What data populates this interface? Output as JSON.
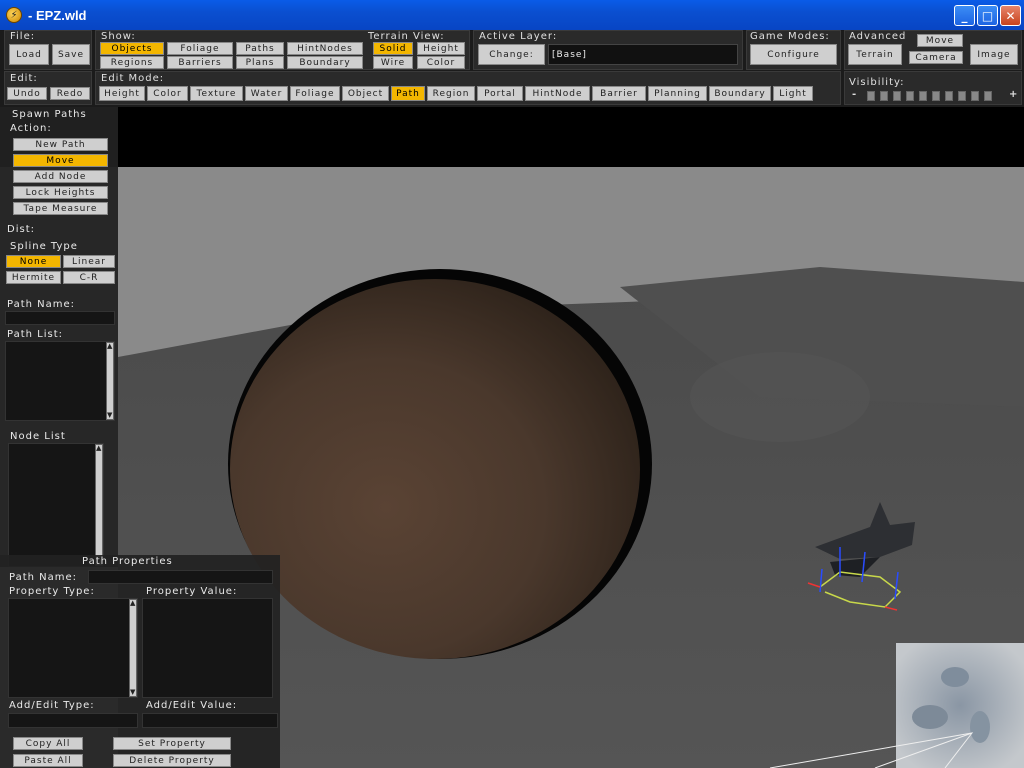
{
  "window": {
    "title": "- EPZ.wld",
    "app_icon": "app-icon"
  },
  "toolbar": {
    "file": {
      "label": "File:",
      "load": "Load",
      "save": "Save"
    },
    "show": {
      "label": "Show:",
      "buttons": [
        "Objects",
        "Foliage",
        "Paths",
        "HintNodes",
        "Regions",
        "Barriers",
        "Plans",
        "Boundary"
      ],
      "active": "Objects"
    },
    "terrain_view": {
      "label": "Terrain View:",
      "buttons": [
        "Solid",
        "Height",
        "Wire",
        "Color"
      ],
      "active": "Solid"
    },
    "active_layer": {
      "label": "Active Layer:",
      "change": "Change:",
      "value": "[Base]"
    },
    "game_modes": {
      "label": "Game Modes:",
      "configure": "Configure"
    },
    "advanced": {
      "label": "Advanced",
      "terrain": "Terrain",
      "move": "Move",
      "camera": "Camera",
      "image": "Image"
    },
    "edit": {
      "label": "Edit:",
      "undo": "Undo",
      "redo": "Redo"
    },
    "edit_mode": {
      "label": "Edit Mode:",
      "buttons": [
        "Height",
        "Color",
        "Texture",
        "Water",
        "Foliage",
        "Object",
        "Path",
        "Region",
        "Portal",
        "HintNode",
        "Barrier",
        "Planning",
        "Boundary",
        "Light"
      ],
      "active": "Path"
    },
    "visibility": {
      "label": "Visibility:",
      "minus": "-",
      "plus": "+",
      "slots": 10
    }
  },
  "spawn_panel": {
    "title": "Spawn Paths",
    "action_label": "Action:",
    "actions": [
      "New Path",
      "Move",
      "Add Node",
      "Lock Heights",
      "Tape Measure"
    ],
    "active_action": "Move",
    "dist_label": "Dist:",
    "spline_label": "Spline Type",
    "splines": [
      "None",
      "Linear",
      "Hermite",
      "C-R"
    ],
    "active_spline": "None",
    "path_name_label": "Path Name:",
    "path_name_value": "",
    "path_list_label": "Path List:",
    "node_list_label": "Node List"
  },
  "properties_panel": {
    "title": "Path Properties",
    "path_name_label": "Path Name:",
    "path_name_value": "",
    "property_type_label": "Property Type:",
    "property_value_label": "Property Value:",
    "add_edit_type_label": "Add/Edit Type:",
    "add_edit_value_label": "Add/Edit Value:",
    "copy_all": "Copy All",
    "paste_all": "Paste All",
    "set_property": "Set Property",
    "delete_property": "Delete Property"
  },
  "colors": {
    "active": "#f3b600",
    "title_bar": "#0a4fd0",
    "panel": "#222222"
  }
}
